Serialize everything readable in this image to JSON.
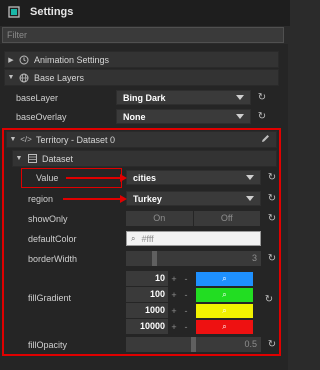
{
  "header": {
    "title": "Settings",
    "icon": "panel-icon"
  },
  "filter": {
    "placeholder": "Filter"
  },
  "sections": {
    "animation": {
      "title": "Animation Settings"
    },
    "base_layers": {
      "title": "Base Layers"
    },
    "territory": {
      "title": "Territory - Dataset 0"
    },
    "dataset": {
      "title": "Dataset"
    }
  },
  "base_layers": {
    "baseLayer": {
      "label": "baseLayer",
      "value": "Bing Dark"
    },
    "baseOverlay": {
      "label": "baseOverlay",
      "value": "None"
    }
  },
  "dataset": {
    "value": {
      "label": "Value",
      "value": "cities"
    },
    "region": {
      "label": "region",
      "value": "Turkey"
    },
    "showOnly": {
      "label": "showOnly",
      "on": "On",
      "off": "Off"
    },
    "defaultColor": {
      "label": "defaultColor",
      "value": "#fff"
    },
    "borderWidth": {
      "label": "borderWidth",
      "value": "3",
      "level": 0.2
    },
    "fillGradient": {
      "label": "fillGradient",
      "stops": [
        {
          "value": "10",
          "color": "#1e90ff"
        },
        {
          "value": "100",
          "color": "#22dd22"
        },
        {
          "value": "1000",
          "color": "#f2f200"
        },
        {
          "value": "10000",
          "color": "#ee1111"
        }
      ],
      "plus": "+",
      "minus": "-"
    },
    "fillOpacity": {
      "label": "fillOpacity",
      "value": "0.5",
      "level": 0.5
    }
  },
  "colors": {
    "accent_red": "#e00000",
    "panel_bg": "#252525",
    "header_bg": "#1e1e1e"
  }
}
